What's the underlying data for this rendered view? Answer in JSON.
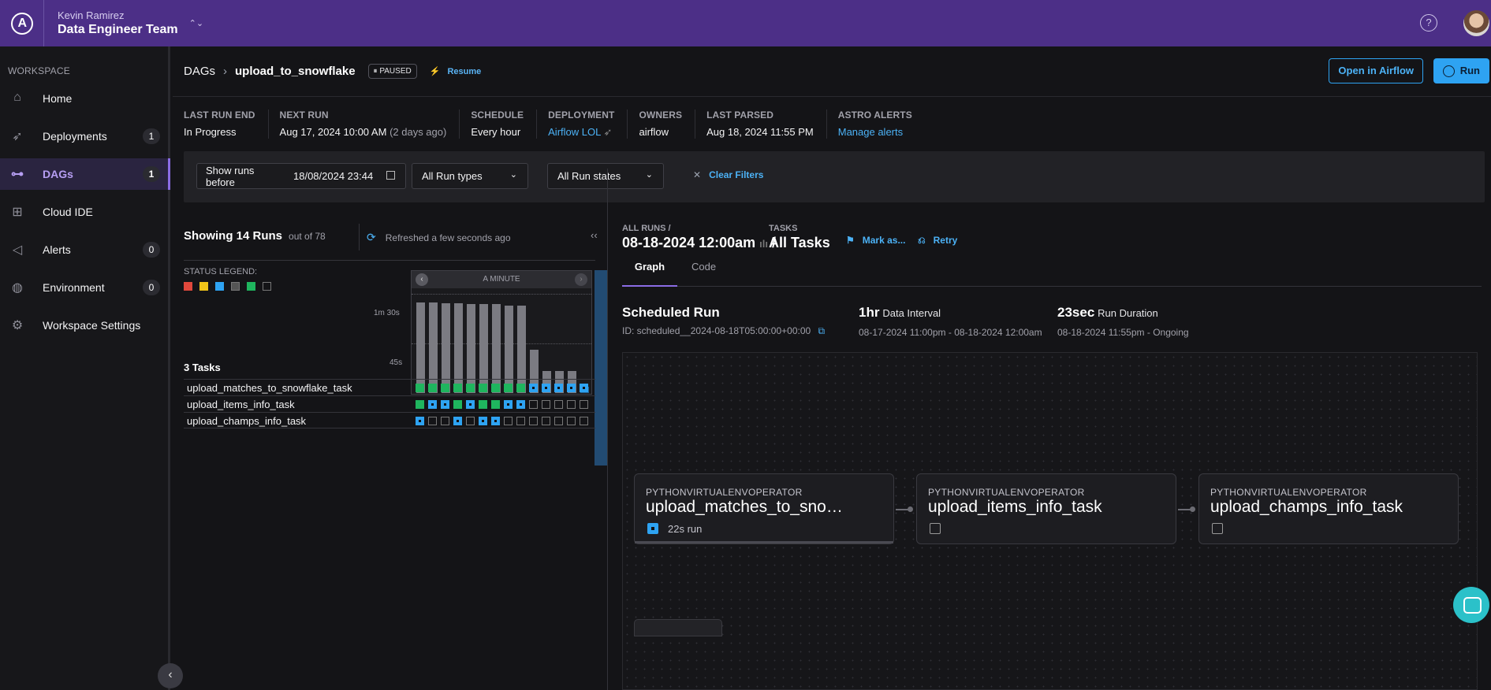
{
  "topbar": {
    "user": "Kevin Ramirez",
    "team": "Data Engineer Team",
    "help": "?"
  },
  "sidebar": {
    "section": "WORKSPACE",
    "items": [
      {
        "label": "Home",
        "icon": "home-icon",
        "badge": ""
      },
      {
        "label": "Deployments",
        "icon": "rocket-icon",
        "badge": "1"
      },
      {
        "label": "DAGs",
        "icon": "dag-icon",
        "badge": "1",
        "active": true
      },
      {
        "label": "Cloud IDE",
        "icon": "cubes-icon",
        "badge": ""
      },
      {
        "label": "Alerts",
        "icon": "megaphone-icon",
        "badge": "0"
      },
      {
        "label": "Environment",
        "icon": "globe-icon",
        "badge": "0"
      },
      {
        "label": "Workspace Settings",
        "icon": "gear-icon",
        "badge": ""
      }
    ]
  },
  "header": {
    "crumb": "DAGs",
    "dag": "upload_to_snowflake",
    "status": "PAUSED",
    "resume": "Resume",
    "open_airflow": "Open in Airflow",
    "run": "Run"
  },
  "meta": {
    "last_run_end": {
      "k": "LAST RUN END",
      "v": "In Progress"
    },
    "next_run": {
      "k": "NEXT RUN",
      "v": "Aug 17, 2024 10:00 AM",
      "note": "(2 days ago)"
    },
    "schedule": {
      "k": "SCHEDULE",
      "v": "Every hour"
    },
    "deployment": {
      "k": "DEPLOYMENT",
      "v": "Airflow LOL"
    },
    "owners": {
      "k": "OWNERS",
      "v": "airflow"
    },
    "last_parsed": {
      "k": "LAST PARSED",
      "v": "Aug 18, 2024 11:55 PM"
    },
    "alerts": {
      "k": "ASTRO ALERTS",
      "v": "Manage alerts"
    }
  },
  "filters": {
    "date_label": "Show runs before",
    "date_value": "18/08/2024  23:44",
    "run_types": "All Run types",
    "run_states": "All Run states",
    "clear": "Clear Filters"
  },
  "runs": {
    "showing": "Showing 14 Runs",
    "of": "out of 78",
    "refreshed": "Refreshed a few seconds ago",
    "legend": "STATUS LEGEND:",
    "chart_header": "A MINUTE",
    "y_ticks": [
      "1m 30s",
      "45s"
    ],
    "durations_sec": [
      90,
      90,
      89,
      89,
      88,
      88,
      88,
      87,
      87,
      43,
      22,
      22,
      22,
      4
    ],
    "tasks_title": "3 Tasks",
    "tasks": [
      {
        "name": "upload_matches_to_snowflake_task",
        "states": [
          "g",
          "g",
          "g",
          "g",
          "g",
          "g",
          "g",
          "g",
          "g",
          "b",
          "b",
          "b",
          "b",
          "b"
        ]
      },
      {
        "name": "upload_items_info_task",
        "states": [
          "g",
          "b",
          "b",
          "g",
          "b",
          "g",
          "g",
          "b",
          "b",
          "e",
          "e",
          "e",
          "e",
          "e"
        ]
      },
      {
        "name": "upload_champs_info_task",
        "states": [
          "b",
          "e",
          "e",
          "b",
          "e",
          "b",
          "b",
          "e",
          "e",
          "e",
          "e",
          "e",
          "e",
          "e"
        ]
      }
    ]
  },
  "detail": {
    "all_runs": "ALL RUNS /",
    "run_date": "08-18-2024 12:00am",
    "tasks_k": "TASKS",
    "tasks_v": "All Tasks",
    "mark": "Mark as...",
    "retry": "Retry",
    "tab_graph": "Graph",
    "tab_code": "Code",
    "scheduled": "Scheduled Run",
    "run_id": "ID: scheduled__2024-08-18T05:00:00+00:00",
    "interval_big": "1hr",
    "interval_label": "Data Interval",
    "interval_sub": "08-17-2024 11:00pm - 08-18-2024 12:00am",
    "dur_big": "23sec",
    "dur_label": "Run Duration",
    "dur_sub": "08-18-2024 11:55pm - Ongoing"
  },
  "graph": {
    "nodes": [
      {
        "op": "PYTHONVIRTUALENVOPERATOR",
        "name": "upload_matches_to_snowflake_task",
        "state": "running",
        "label": "22s run"
      },
      {
        "op": "PYTHONVIRTUALENVOPERATOR",
        "name": "upload_items_info_task",
        "state": "none",
        "label": ""
      },
      {
        "op": "PYTHONVIRTUALENVOPERATOR",
        "name": "upload_champs_info_task",
        "state": "none",
        "label": ""
      }
    ]
  }
}
